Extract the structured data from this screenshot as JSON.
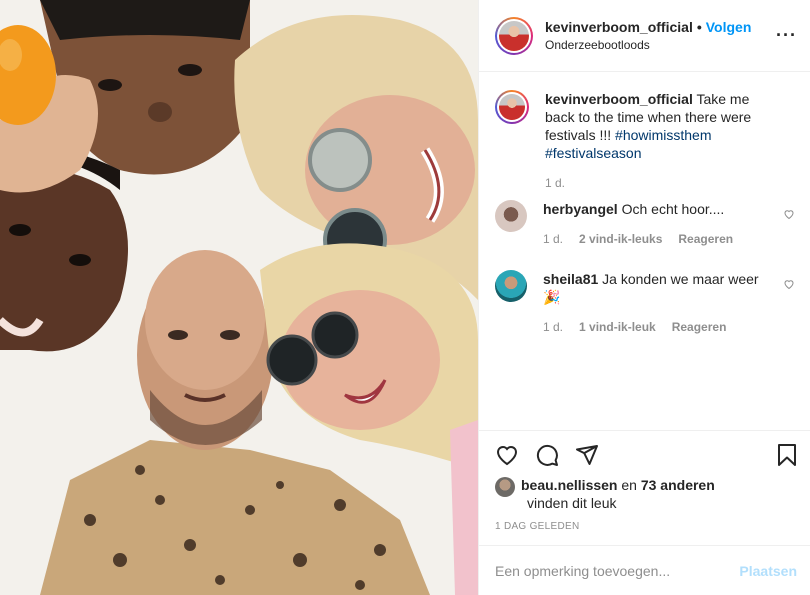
{
  "post": {
    "username": "kevinverboom_official",
    "follow_label": "Volgen",
    "location": "Onderzeebootloods",
    "more_icon": "more-horizontal-icon"
  },
  "caption": {
    "username": "kevinverboom_official",
    "text": "Take me back to the time when there were festivals !!!",
    "hashtags": [
      "#howimissthem",
      "#festivalseason"
    ],
    "time": "1 d."
  },
  "comments": [
    {
      "username": "herbyangel",
      "text": "Och echt hoor....",
      "time": "1 d.",
      "likes": "2 vind-ik-leuks",
      "reply": "Reageren",
      "avatar_color": "#d8c7c0"
    },
    {
      "username": "sheila81",
      "text": "Ja konden we maar weer",
      "emoji": "🎉",
      "time": "1 d.",
      "likes": "1 vind-ik-leuk",
      "reply": "Reageren",
      "avatar_color": "#2aa6b6"
    }
  ],
  "actions": {
    "like_icon": "heart-icon",
    "comment_icon": "comment-bubble-icon",
    "share_icon": "paper-plane-icon",
    "save_icon": "bookmark-icon"
  },
  "likes": {
    "user": "beau.nellissen",
    "joiner": "en",
    "others": "73 anderen",
    "suffix": "vinden dit leuk"
  },
  "date": "1 DAG GELEDEN",
  "add_comment": {
    "placeholder": "Een opmerking toevoegen...",
    "post_label": "Plaatsen"
  },
  "colors": {
    "accent": "#0095f6",
    "post_disabled": "#b2dffc",
    "hashtag": "#00376b",
    "muted": "#8e8e8e"
  }
}
